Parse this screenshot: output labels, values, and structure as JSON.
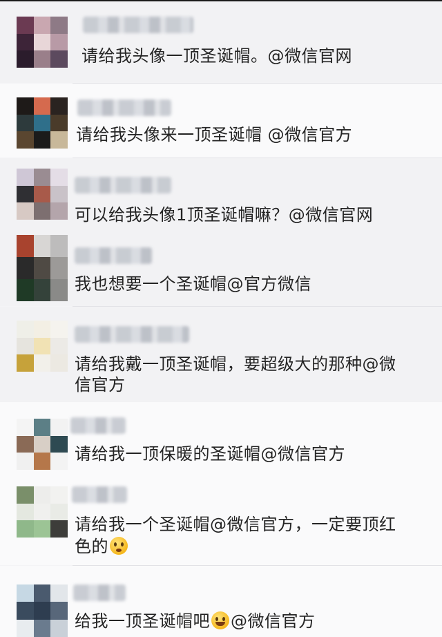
{
  "comments": [
    {
      "text": "请给我头像一顶圣诞帽。@微信官网"
    },
    {
      "text": "请给我头像来一顶圣诞帽 @微信官方"
    },
    {
      "text": "可以给我头像1顶圣诞帽嘛？@微信官网"
    },
    {
      "text": "我也想要一个圣诞帽@官方微信"
    },
    {
      "line1": "请给我戴一顶圣诞帽，要超级大的那种@微",
      "line2": "信官方"
    },
    {
      "text": "请给我一顶保暖的圣诞帽@微信官方"
    },
    {
      "line1": "请给我一个圣诞帽@微信官方，一定要顶红",
      "line2": "色的",
      "emoji": "flushed-face-emoji"
    },
    {
      "text_before": "给我一顶圣诞帽吧",
      "emoji": "grinning-face-emoji",
      "text_after": "@微信官方"
    }
  ]
}
